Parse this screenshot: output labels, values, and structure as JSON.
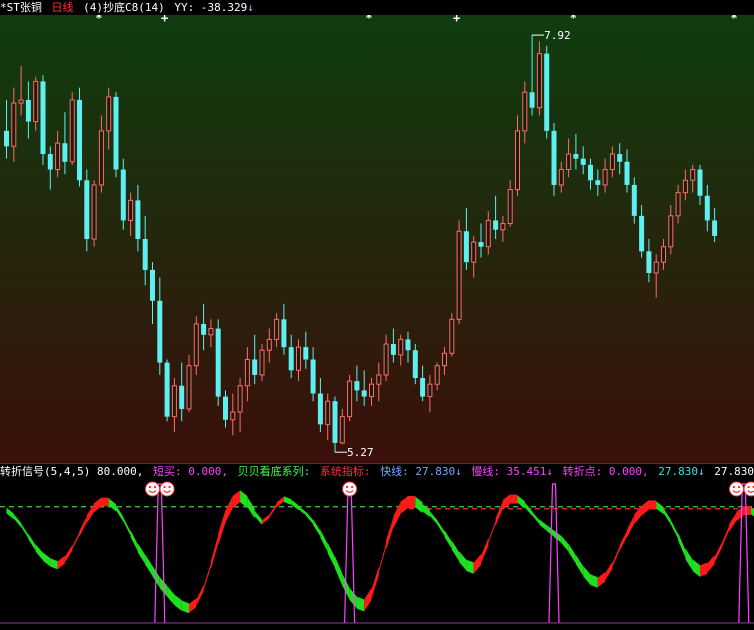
{
  "header": {
    "stock_name": "*ST张铜",
    "period": "日线",
    "indicator": "(4)抄底C8(14)",
    "yy_label": "YY:",
    "yy_value": "-38.329",
    "yy_arrow": "↓"
  },
  "main_chart": {
    "bg_top": "#0f3d0f",
    "bg_bottom": "#3a0f0a",
    "up_color": "#ff6b6b",
    "down_color": "#5ef0f0",
    "high_label": "7.92",
    "low_label": "5.27",
    "markers": [
      {
        "x_index": 13,
        "glyph": "*"
      },
      {
        "x_index": 22,
        "glyph": "+"
      },
      {
        "x_index": 50,
        "glyph": "*"
      },
      {
        "x_index": 62,
        "glyph": "+"
      },
      {
        "x_index": 78,
        "glyph": "*"
      },
      {
        "x_index": 100,
        "glyph": "*"
      }
    ]
  },
  "chart_data": {
    "type": "candlestick",
    "ylim": [
      5.15,
      8.05
    ],
    "ohlc": [
      [
        7.3,
        7.5,
        7.12,
        7.2
      ],
      [
        7.2,
        7.58,
        7.1,
        7.48
      ],
      [
        7.48,
        7.72,
        7.4,
        7.5
      ],
      [
        7.5,
        7.62,
        7.25,
        7.36
      ],
      [
        7.36,
        7.65,
        7.3,
        7.62
      ],
      [
        7.62,
        7.66,
        7.08,
        7.15
      ],
      [
        7.15,
        7.2,
        6.92,
        7.05
      ],
      [
        7.05,
        7.3,
        7.0,
        7.22
      ],
      [
        7.22,
        7.42,
        7.02,
        7.1
      ],
      [
        7.1,
        7.55,
        7.08,
        7.5
      ],
      [
        7.5,
        7.58,
        6.94,
        6.98
      ],
      [
        6.98,
        7.05,
        6.52,
        6.6
      ],
      [
        6.6,
        6.98,
        6.55,
        6.95
      ],
      [
        6.95,
        7.4,
        6.9,
        7.3
      ],
      [
        7.3,
        7.58,
        7.18,
        7.52
      ],
      [
        7.52,
        7.55,
        7.0,
        7.05
      ],
      [
        7.05,
        7.12,
        6.66,
        6.72
      ],
      [
        6.72,
        6.9,
        6.62,
        6.85
      ],
      [
        6.85,
        6.95,
        6.52,
        6.6
      ],
      [
        6.6,
        6.75,
        6.3,
        6.4
      ],
      [
        6.4,
        6.45,
        6.05,
        6.2
      ],
      [
        6.2,
        6.35,
        5.72,
        5.8
      ],
      [
        5.8,
        5.82,
        5.42,
        5.45
      ],
      [
        5.45,
        5.7,
        5.35,
        5.65
      ],
      [
        5.65,
        5.8,
        5.42,
        5.5
      ],
      [
        5.5,
        5.85,
        5.48,
        5.78
      ],
      [
        5.78,
        6.1,
        5.72,
        6.05
      ],
      [
        6.05,
        6.18,
        5.88,
        5.98
      ],
      [
        5.98,
        6.08,
        5.9,
        6.02
      ],
      [
        6.02,
        6.08,
        5.52,
        5.58
      ],
      [
        5.58,
        5.62,
        5.38,
        5.43
      ],
      [
        5.43,
        5.6,
        5.33,
        5.48
      ],
      [
        5.48,
        5.7,
        5.35,
        5.65
      ],
      [
        5.65,
        5.9,
        5.55,
        5.82
      ],
      [
        5.82,
        5.98,
        5.66,
        5.72
      ],
      [
        5.72,
        5.92,
        5.68,
        5.88
      ],
      [
        5.88,
        6.02,
        5.8,
        5.95
      ],
      [
        5.95,
        6.12,
        5.9,
        6.08
      ],
      [
        6.08,
        6.18,
        5.85,
        5.9
      ],
      [
        5.9,
        5.98,
        5.7,
        5.75
      ],
      [
        5.75,
        5.95,
        5.68,
        5.9
      ],
      [
        5.9,
        6.0,
        5.76,
        5.82
      ],
      [
        5.82,
        5.9,
        5.55,
        5.6
      ],
      [
        5.6,
        5.7,
        5.35,
        5.4
      ],
      [
        5.4,
        5.6,
        5.3,
        5.55
      ],
      [
        5.55,
        5.58,
        5.22,
        5.28
      ],
      [
        5.28,
        5.5,
        5.27,
        5.45
      ],
      [
        5.45,
        5.72,
        5.42,
        5.68
      ],
      [
        5.68,
        5.78,
        5.55,
        5.62
      ],
      [
        5.62,
        5.75,
        5.52,
        5.58
      ],
      [
        5.58,
        5.7,
        5.52,
        5.66
      ],
      [
        5.66,
        5.8,
        5.55,
        5.72
      ],
      [
        5.72,
        5.98,
        5.68,
        5.92
      ],
      [
        5.92,
        6.02,
        5.8,
        5.85
      ],
      [
        5.85,
        5.98,
        5.78,
        5.95
      ],
      [
        5.95,
        6.0,
        5.8,
        5.88
      ],
      [
        5.88,
        5.92,
        5.66,
        5.7
      ],
      [
        5.7,
        5.78,
        5.55,
        5.58
      ],
      [
        5.58,
        5.72,
        5.48,
        5.66
      ],
      [
        5.66,
        5.8,
        5.62,
        5.78
      ],
      [
        5.78,
        5.9,
        5.72,
        5.86
      ],
      [
        5.86,
        6.12,
        5.84,
        6.08
      ],
      [
        6.08,
        6.72,
        6.05,
        6.65
      ],
      [
        6.65,
        6.8,
        6.4,
        6.45
      ],
      [
        6.45,
        6.62,
        6.35,
        6.58
      ],
      [
        6.58,
        6.7,
        6.48,
        6.55
      ],
      [
        6.55,
        6.78,
        6.5,
        6.72
      ],
      [
        6.72,
        6.88,
        6.6,
        6.66
      ],
      [
        6.66,
        6.75,
        6.58,
        6.7
      ],
      [
        6.7,
        6.98,
        6.68,
        6.92
      ],
      [
        6.92,
        7.4,
        6.88,
        7.3
      ],
      [
        7.3,
        7.62,
        7.22,
        7.55
      ],
      [
        7.55,
        7.92,
        7.4,
        7.45
      ],
      [
        7.45,
        7.88,
        7.4,
        7.8
      ],
      [
        7.8,
        7.85,
        7.25,
        7.3
      ],
      [
        7.3,
        7.35,
        6.88,
        6.95
      ],
      [
        6.95,
        7.1,
        6.9,
        7.05
      ],
      [
        7.05,
        7.25,
        7.0,
        7.15
      ],
      [
        7.15,
        7.28,
        7.05,
        7.12
      ],
      [
        7.12,
        7.2,
        7.02,
        7.08
      ],
      [
        7.08,
        7.12,
        6.92,
        6.98
      ],
      [
        6.98,
        7.05,
        6.88,
        6.95
      ],
      [
        6.95,
        7.12,
        6.9,
        7.05
      ],
      [
        7.05,
        7.2,
        7.0,
        7.15
      ],
      [
        7.15,
        7.22,
        7.02,
        7.1
      ],
      [
        7.1,
        7.18,
        6.9,
        6.95
      ],
      [
        6.95,
        7.0,
        6.7,
        6.75
      ],
      [
        6.75,
        6.82,
        6.48,
        6.52
      ],
      [
        6.52,
        6.6,
        6.32,
        6.38
      ],
      [
        6.38,
        6.5,
        6.22,
        6.45
      ],
      [
        6.45,
        6.6,
        6.4,
        6.55
      ],
      [
        6.55,
        6.82,
        6.5,
        6.75
      ],
      [
        6.75,
        6.95,
        6.7,
        6.9
      ],
      [
        6.9,
        7.05,
        6.85,
        6.98
      ],
      [
        6.98,
        7.08,
        6.9,
        7.05
      ],
      [
        7.05,
        7.08,
        6.82,
        6.88
      ],
      [
        6.88,
        6.95,
        6.65,
        6.72
      ],
      [
        6.72,
        6.8,
        6.58,
        6.62
      ]
    ],
    "sub": {
      "ylim": [
        -5,
        100
      ],
      "ref_line_green": 80,
      "ref_line_red": 80,
      "fast": [
        78,
        74,
        68,
        60,
        52,
        46,
        42,
        40,
        44,
        52,
        62,
        72,
        80,
        84,
        84,
        80,
        72,
        62,
        52,
        44,
        36,
        28,
        22,
        16,
        12,
        10,
        14,
        24,
        40,
        58,
        74,
        84,
        88,
        84,
        76,
        70,
        74,
        82,
        86,
        84,
        80,
        76,
        70,
        62,
        52,
        42,
        30,
        20,
        14,
        12,
        20,
        36,
        54,
        70,
        80,
        84,
        84,
        80,
        76,
        70,
        62,
        54,
        46,
        40,
        38,
        44,
        56,
        70,
        82,
        86,
        86,
        82,
        76,
        70,
        66,
        62,
        58,
        52,
        44,
        36,
        30,
        28,
        32,
        40,
        52,
        62,
        72,
        78,
        82,
        82,
        78,
        70,
        60,
        48,
        40,
        36,
        38,
        44,
        54,
        66,
        74,
        78,
        78,
        74,
        68
      ],
      "slow": [
        70,
        70,
        69,
        67,
        64,
        61,
        57,
        54,
        52,
        52,
        54,
        58,
        63,
        68,
        72,
        74,
        75,
        73,
        69,
        64,
        58,
        51,
        44,
        38,
        32,
        27,
        23,
        22,
        25,
        31,
        39,
        48,
        57,
        64,
        69,
        72,
        74,
        76,
        78,
        79,
        79,
        79,
        78,
        76,
        73,
        68,
        62,
        55,
        48,
        42,
        37,
        34,
        35,
        40,
        47,
        55,
        62,
        68,
        72,
        74,
        73,
        71,
        68,
        64,
        60,
        57,
        56,
        58,
        63,
        69,
        74,
        77,
        78,
        77,
        75,
        73,
        70,
        67,
        62,
        57,
        52,
        47,
        43,
        42,
        44,
        48,
        53,
        59,
        65,
        70,
        73,
        74,
        73,
        70,
        65,
        60,
        55,
        51,
        50,
        52,
        56,
        61,
        66,
        70,
        71
      ],
      "signal_indices": [
        21,
        47,
        75,
        101
      ],
      "smiley_indices": [
        20,
        22,
        47,
        100,
        102
      ]
    }
  },
  "sub_header": {
    "name": "转折信号(5,4,5)",
    "value": "80.000,",
    "short_buy_label": "短买:",
    "short_buy_value": "0.000,",
    "series_label": "贝贝看底系列:",
    "system_label": "系统指标:",
    "fast_label": "快线:",
    "fast_value": "27.830",
    "slow_label": "慢线:",
    "slow_value": "35.451",
    "turn_label": "转折点:",
    "turn_value_1": "0.000,",
    "turn_value_2": "27.830",
    "turn_value_3": "27.830",
    "arrow": "↓"
  }
}
